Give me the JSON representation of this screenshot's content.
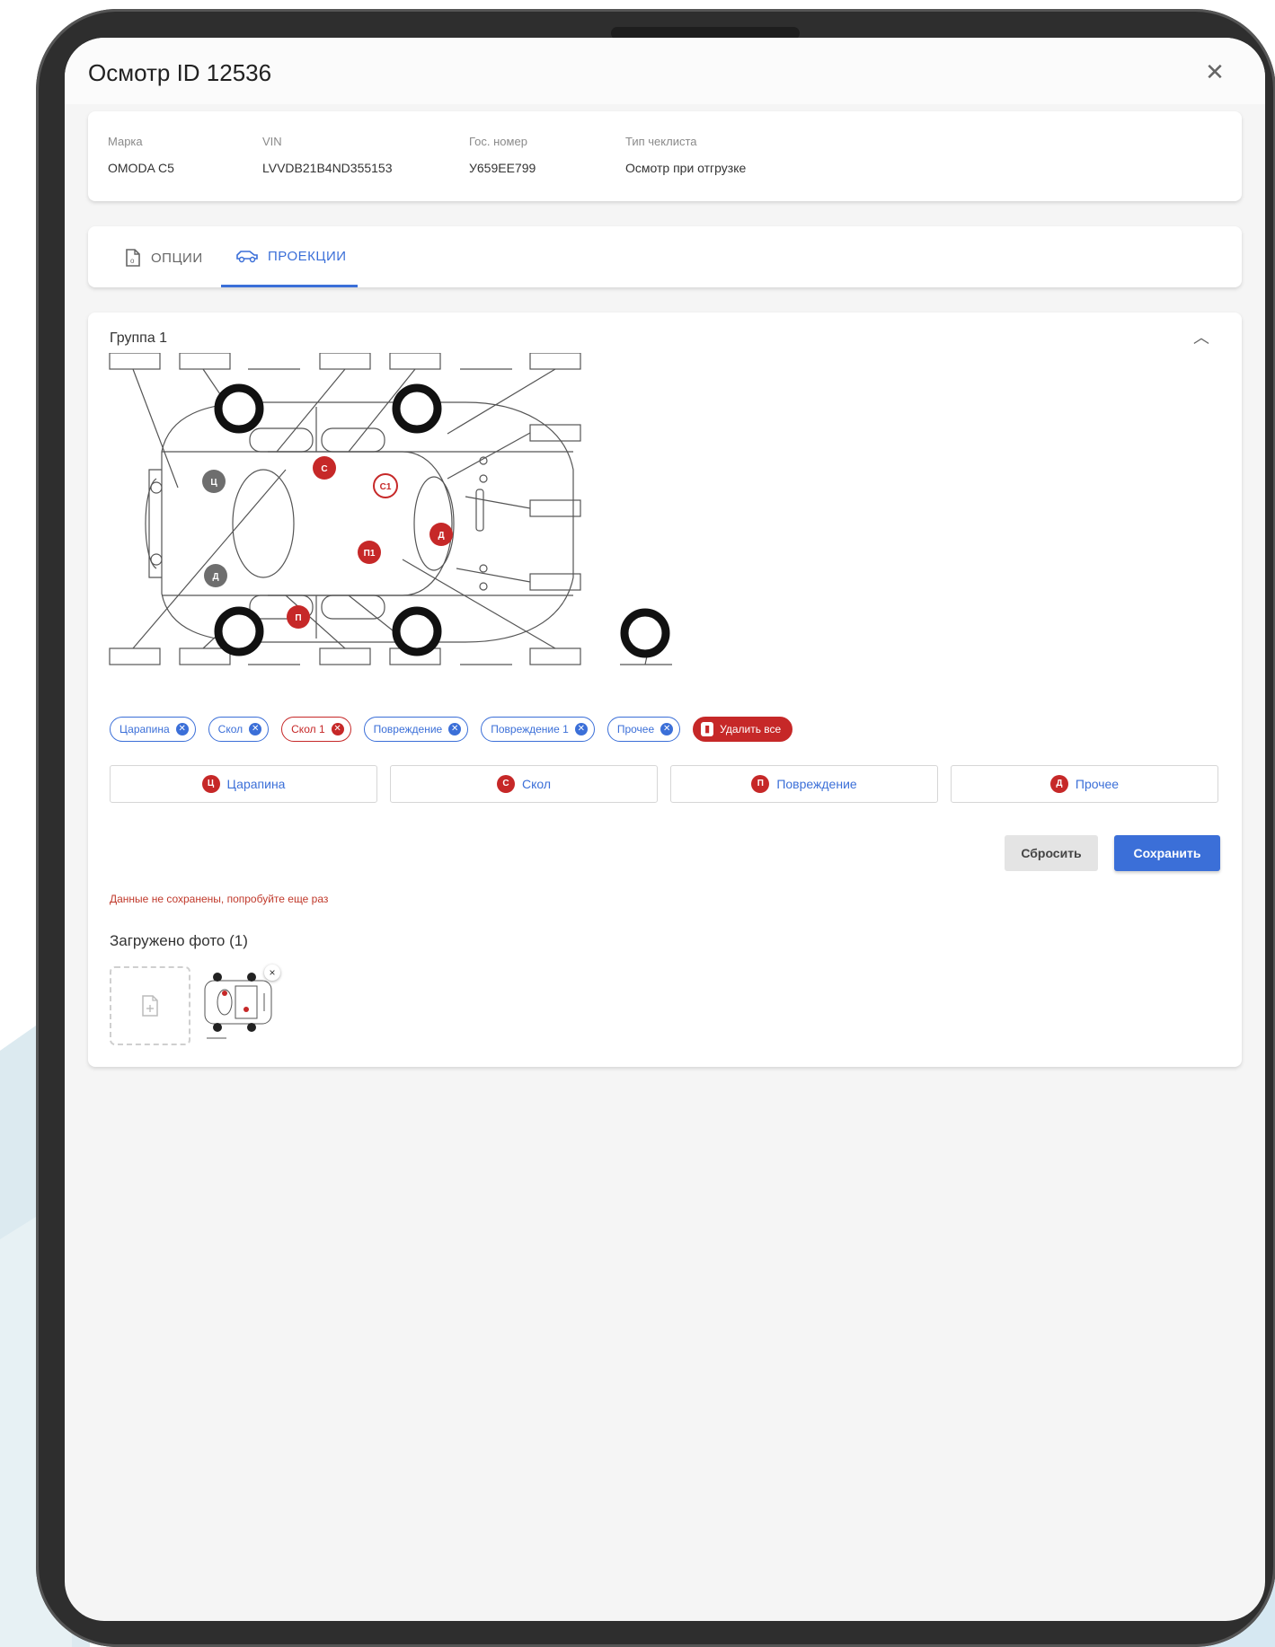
{
  "dialog": {
    "title": "Осмотр ID 12536",
    "close_icon": "close-icon"
  },
  "vehicle_info": {
    "brand": {
      "label": "Марка",
      "value": "OMODA C5"
    },
    "vin": {
      "label": "VIN",
      "value": "LVVDB21B4ND355153"
    },
    "plate": {
      "label": "Гос. номер",
      "value": "У659ЕЕ799"
    },
    "checklist": {
      "label": "Тип чеклиста",
      "value": "Осмотр при отгрузке"
    }
  },
  "tabs": [
    {
      "label": "ОПЦИИ",
      "icon": "document-icon",
      "active": false
    },
    {
      "label": "ПРОЕКЦИИ",
      "icon": "car-icon",
      "active": true
    }
  ],
  "group": {
    "title": "Группа 1",
    "collapse_icon": "chevron-up-icon"
  },
  "diagram_markers": [
    {
      "label": "Ц",
      "state": "gray"
    },
    {
      "label": "С",
      "state": "filled"
    },
    {
      "label": "С1",
      "state": "outline"
    },
    {
      "label": "П1",
      "state": "filled"
    },
    {
      "label": "П",
      "state": "filled"
    },
    {
      "label": "Д",
      "state": "filled"
    },
    {
      "label": "Д",
      "state": "gray"
    }
  ],
  "chips": [
    {
      "label": "Царапина",
      "selected": false
    },
    {
      "label": "Скол",
      "selected": false
    },
    {
      "label": "Скол 1",
      "selected": true
    },
    {
      "label": "Повреждение",
      "selected": false
    },
    {
      "label": "Повреждение 1",
      "selected": false
    },
    {
      "label": "Прочее",
      "selected": false
    }
  ],
  "delete_all_label": "Удалить все",
  "damage_types": [
    {
      "label": "Царапина",
      "badge": "Ц"
    },
    {
      "label": "Скол",
      "badge": "С"
    },
    {
      "label": "Повреждение",
      "badge": "П"
    },
    {
      "label": "Прочее",
      "badge": "Д"
    }
  ],
  "actions": {
    "reset_label": "Сбросить",
    "save_label": "Сохранить"
  },
  "error_message": "Данные не сохранены, попробуйте еще раз",
  "uploaded": {
    "title": "Загружено фото (1)",
    "remove_label": "×"
  },
  "colors": {
    "accent": "#3b6fd8",
    "damage": "#c62828",
    "marker_gray": "#6e6e6e"
  }
}
